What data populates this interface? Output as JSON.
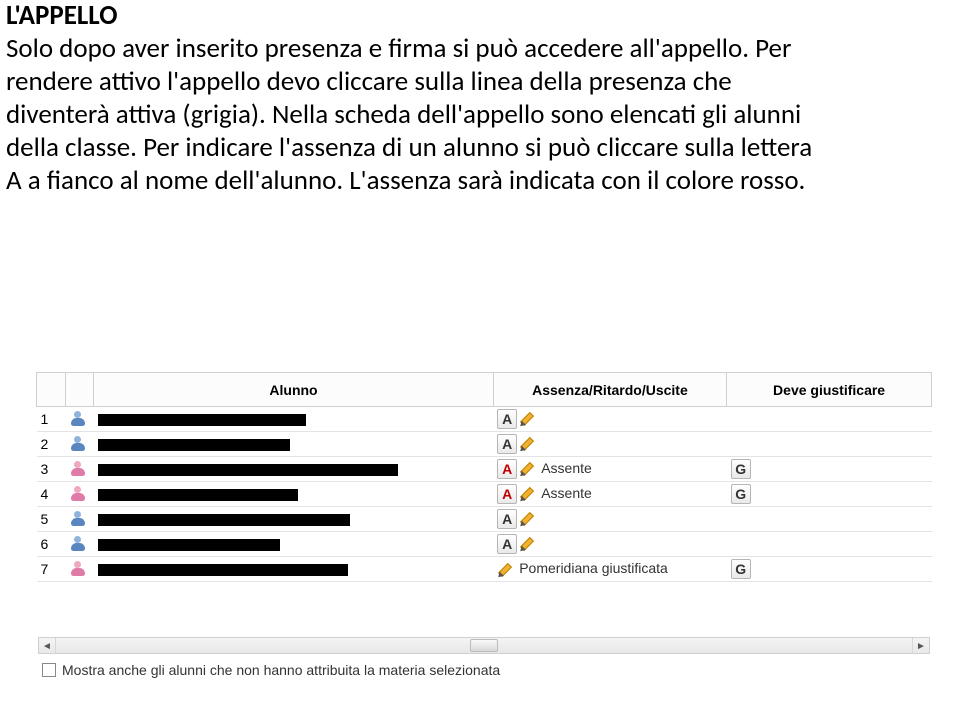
{
  "title": "L'APPELLO",
  "body_lines": [
    "Solo dopo aver inserito presenza e firma si può accedere all'appello. Per",
    "rendere attivo l'appello devo cliccare sulla linea della presenza che",
    "diventerà attiva (grigia). Nella scheda dell'appello sono elencati gli alunni",
    "della classe. Per indicare l'assenza di un alunno si può cliccare  sulla lettera",
    "A a fianco al nome dell'alunno. L'assenza sarà indicata con il colore rosso."
  ],
  "headers": {
    "alunno": "Alunno",
    "assenza": "Assenza/Ritardo/Uscite",
    "giustifica": "Deve giustificare"
  },
  "rows": [
    {
      "n": "1",
      "gender": "blue",
      "show_a": true,
      "a_red": false,
      "status": "",
      "show_g": false,
      "redact_w": 208
    },
    {
      "n": "2",
      "gender": "blue",
      "show_a": true,
      "a_red": false,
      "status": "",
      "show_g": false,
      "redact_w": 192
    },
    {
      "n": "3",
      "gender": "pink",
      "show_a": true,
      "a_red": true,
      "status": "Assente",
      "show_g": true,
      "redact_w": 300
    },
    {
      "n": "4",
      "gender": "pink",
      "show_a": true,
      "a_red": true,
      "status": "Assente",
      "show_g": true,
      "redact_w": 200
    },
    {
      "n": "5",
      "gender": "blue",
      "show_a": true,
      "a_red": false,
      "status": "",
      "show_g": false,
      "redact_w": 252
    },
    {
      "n": "6",
      "gender": "blue",
      "show_a": true,
      "a_red": false,
      "status": "",
      "show_g": false,
      "redact_w": 182
    },
    {
      "n": "7",
      "gender": "pink",
      "show_a": false,
      "a_red": false,
      "status": "Pomeridiana giustificata",
      "show_g": true,
      "redact_w": 250
    }
  ],
  "footer_label": "Mostra anche gli alunni che non hanno attribuita la materia selezionata",
  "btn_a": "A",
  "btn_g": "G"
}
